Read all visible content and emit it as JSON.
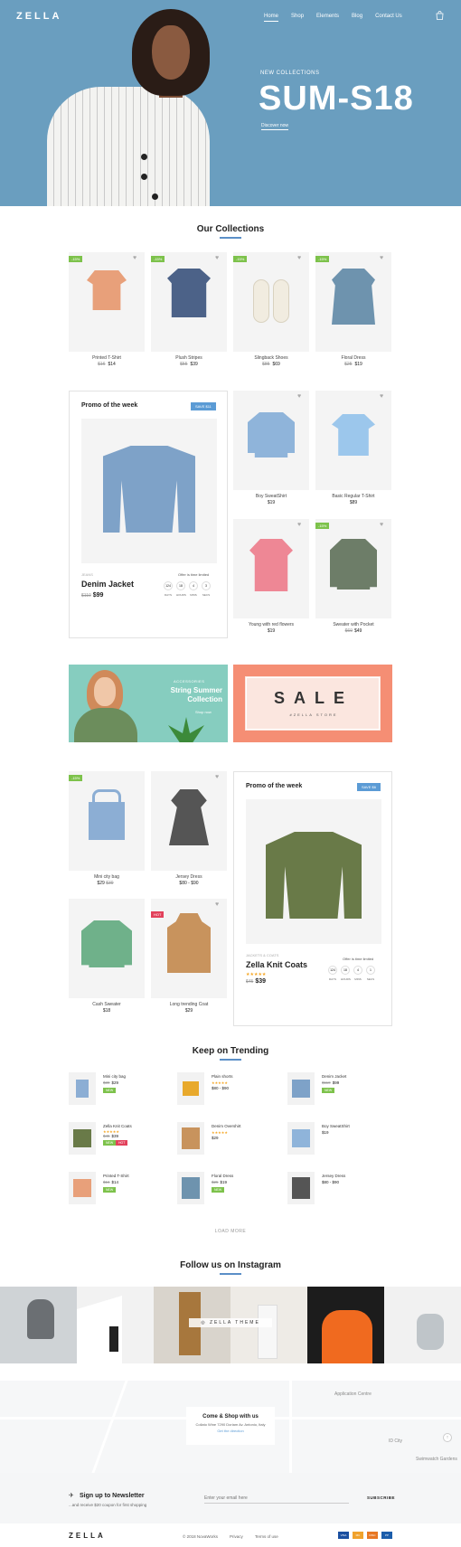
{
  "header": {
    "logo": "ZELLA",
    "nav": [
      "Home",
      "Shop",
      "Elements",
      "Blog",
      "Contact Us"
    ],
    "cart_icon": "bag-icon"
  },
  "hero": {
    "subtitle": "NEW COLLECTIONS",
    "title": "SUM-S18",
    "link": "Discover now"
  },
  "collections": {
    "title": "Our Collections",
    "products": [
      {
        "name": "Printed T-Shirt",
        "old": "$16",
        "price": "$14",
        "tag": "-15%"
      },
      {
        "name": "Plush Stripes",
        "old": "$55",
        "price": "$39",
        "tag": "-15%"
      },
      {
        "name": "Slingback Shoes",
        "old": "$85",
        "price": "$69",
        "tag": "-15%"
      },
      {
        "name": "Floral Dress",
        "old": "$25",
        "price": "$19",
        "tag": "-15%"
      }
    ]
  },
  "promo1": {
    "title": "Promo of the week",
    "save": "SAVE $11",
    "brand": "JEANS",
    "offer": "Offer is time limited",
    "name": "Denim Jacket",
    "old": "$110",
    "price": "$99",
    "countdown": [
      "124",
      "18",
      "4",
      "3"
    ],
    "countdown_labels": [
      "DAYS",
      "HOURS",
      "MINS",
      "SECS"
    ]
  },
  "grid1": [
    {
      "name": "Boy SweatShirt",
      "price": "$19",
      "tag": ""
    },
    {
      "name": "Basic Regular T-Shirt",
      "price": "$89",
      "tag": ""
    },
    {
      "name": "Young with red flowers",
      "price": "$19",
      "tag": ""
    },
    {
      "name": "Sweater with Pocket",
      "old": "$69",
      "price": "$49",
      "tag": "-15%"
    }
  ],
  "banners": {
    "left_kicker": "ACCESSORIES",
    "left_title_1": "String Summer",
    "left_title_2": "Collection",
    "left_link": "Shop now",
    "sale": "SALE",
    "sale_sub": "#ZELLA STORE"
  },
  "grid2": [
    {
      "name": "Mini city bag",
      "old": "$39",
      "price": "$29",
      "tag": "-15%"
    },
    {
      "name": "Jersey Dress",
      "price": "$80 - $90",
      "tag": ""
    },
    {
      "name": "Cash Sweater",
      "price": "$18",
      "tag": ""
    },
    {
      "name": "Long trending Coat",
      "price": "$29",
      "tag": "HOT"
    }
  ],
  "promo2": {
    "title": "Promo of the week",
    "save": "SAVE $6",
    "brand": "JACKETS & COATS",
    "offer": "Offer is time limited",
    "name": "Zella Knit Coats",
    "stars": "★★★★★",
    "old": "$45",
    "price": "$39",
    "countdown": [
      "124",
      "18",
      "4",
      "1"
    ],
    "countdown_labels": [
      "DAYS",
      "HOURS",
      "MINS",
      "SECS"
    ]
  },
  "trending": {
    "title": "Keep on Trending",
    "items": [
      {
        "name": "Mini city bag",
        "old": "$39",
        "price": "$29",
        "pill": "NEW"
      },
      {
        "name": "Plain shorts",
        "price": "$80 - $90",
        "stars": "★★★★★"
      },
      {
        "name": "Denim Jacket",
        "old": "$110",
        "price": "$99",
        "pill": "NEW"
      },
      {
        "name": "Zella Knit Coats",
        "stars": "★★★★★",
        "old": "$45",
        "price": "$39",
        "pill": "NEW",
        "pill2": "HOT"
      },
      {
        "name": "Denim Overshirt",
        "stars": "★★★★★",
        "price": "$29"
      },
      {
        "name": "Boy SweatShirt",
        "price": "$19"
      },
      {
        "name": "Printed T-Shirt",
        "old": "$16",
        "price": "$14",
        "pill": "NEW"
      },
      {
        "name": "Floral Dress",
        "old": "$25",
        "price": "$19",
        "pill": "NEW"
      },
      {
        "name": "Jersey Dress",
        "price": "$80 - $90"
      }
    ],
    "load_more": "LOAD MORE"
  },
  "instagram": {
    "title": "Follow us on Instagram",
    "label": "ZELLA THEME"
  },
  "map": {
    "card_title": "Come & Shop with us",
    "address": "Collato Wine 7290 Doriam Av. Antonio, Italy",
    "link": "Get the direction",
    "labels": [
      "Application Centre",
      "ID City",
      "Swimwatch Gardens"
    ]
  },
  "newsletter": {
    "title": "Sign up to Newsletter",
    "sub": "...and receive $20 coupon for first shopping",
    "placeholder": "Enter your email here",
    "button": "SUBSCRIBE"
  },
  "footer": {
    "logo": "ZELLA",
    "copyright": "© 2018 NovaWorks",
    "links": [
      "Privacy",
      "Terms of use"
    ],
    "payments": [
      "VISA",
      "MC",
      "DISC",
      "PP"
    ]
  },
  "colors": {
    "hero": "#6a9ebf",
    "accent": "#5b9bd5",
    "green": "#7dc24b",
    "red": "#e2415b",
    "salmon": "#f58e74",
    "mint": "#86cdbf"
  }
}
